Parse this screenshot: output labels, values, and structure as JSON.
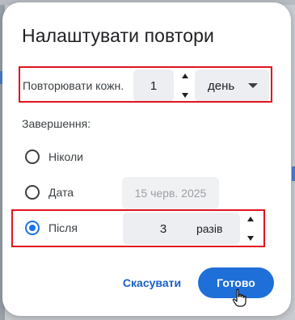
{
  "dialog": {
    "title": "Налаштувати повтори",
    "repeat": {
      "label": "Повторювати кожн.",
      "interval_value": "1",
      "unit_selected": "день"
    },
    "ends": {
      "label": "Завершення:",
      "options": [
        {
          "label": "Ніколи",
          "checked": false
        },
        {
          "label": "Дата",
          "checked": false,
          "date_value": "15 черв. 2025"
        },
        {
          "label": "Після",
          "checked": true,
          "count_value": "3",
          "count_unit": "разів"
        }
      ]
    },
    "buttons": {
      "cancel": "Скасувати",
      "done": "Готово"
    }
  },
  "colors": {
    "accent": "#1a73e8",
    "primary_button": "#1f6fd8",
    "highlight_box": "#e1141e"
  },
  "icons": [
    "stepper-up-icon",
    "stepper-down-icon",
    "dropdown-caret-icon",
    "mouse-pointer-hand-icon"
  ]
}
